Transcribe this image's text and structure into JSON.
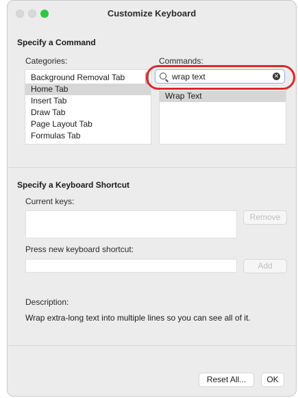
{
  "window": {
    "title": "Customize Keyboard"
  },
  "command_section": {
    "heading": "Specify a Command",
    "categories_label": "Categories:",
    "commands_label": "Commands:",
    "categories": [
      {
        "label": "Background Removal Tab"
      },
      {
        "label": "Home Tab"
      },
      {
        "label": "Insert Tab"
      },
      {
        "label": "Draw Tab"
      },
      {
        "label": "Page Layout Tab"
      },
      {
        "label": "Formulas Tab"
      }
    ],
    "selected_category": "Home Tab",
    "search_value": "wrap text",
    "commands": [
      {
        "label": "Wrap Text"
      }
    ]
  },
  "shortcut_section": {
    "heading": "Specify a Keyboard Shortcut",
    "current_keys_label": "Current keys:",
    "remove_label": "Remove",
    "new_shortcut_label": "Press new keyboard shortcut:",
    "new_shortcut_value": "",
    "add_label": "Add",
    "description_label": "Description:",
    "description_text": "Wrap extra-long text into multiple lines so you can see all of it."
  },
  "footer": {
    "reset_label": "Reset All...",
    "ok_label": "OK"
  },
  "colors": {
    "highlight_ring": "#e0252b",
    "selected_row": "#d7d7d7",
    "green_light": "#2fc840"
  }
}
